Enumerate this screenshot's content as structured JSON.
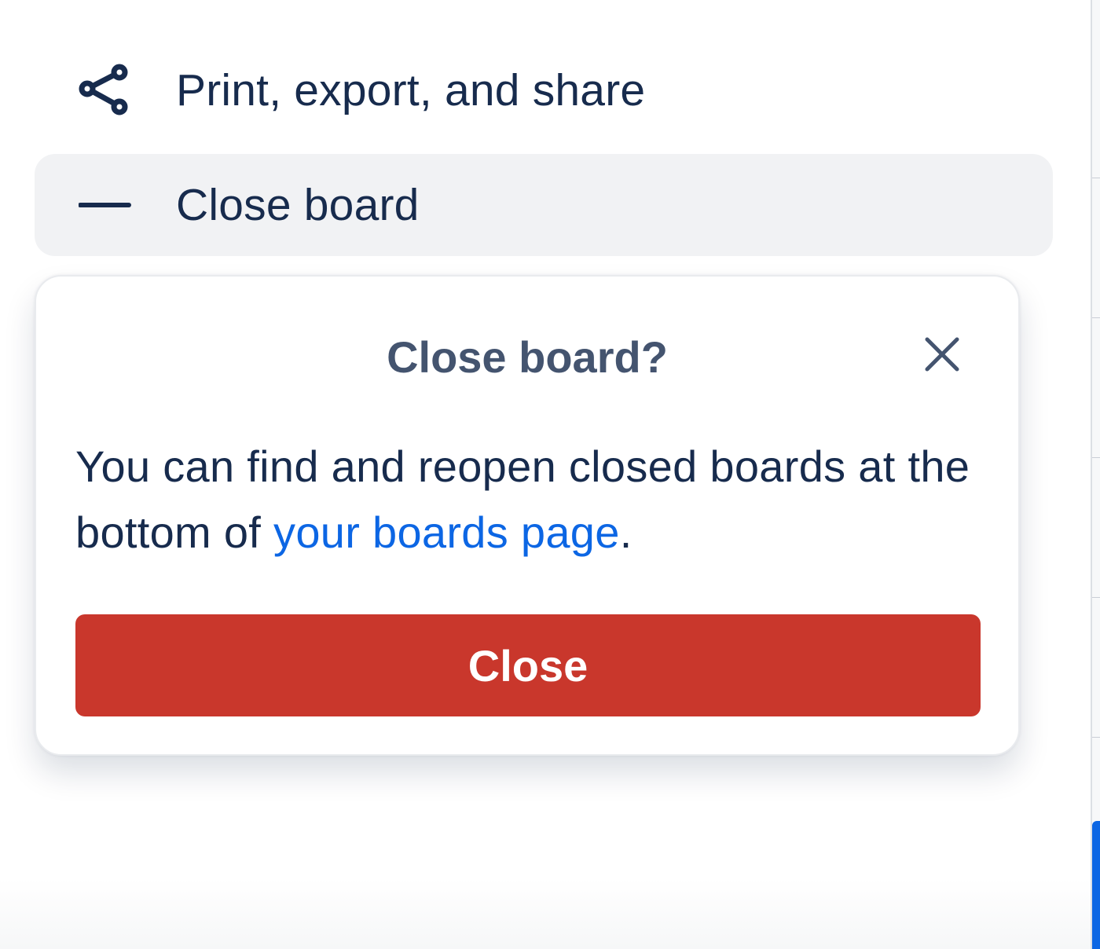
{
  "menu": {
    "share": {
      "label": "Print, export, and share",
      "icon": "share-icon"
    },
    "close_board": {
      "label": "Close board",
      "icon": "minus-icon"
    }
  },
  "popover": {
    "title": "Close board?",
    "close_icon": "close-icon",
    "body_before": "You can find and reopen closed boards at the bottom of ",
    "body_link": "your boards page",
    "body_after": ".",
    "confirm_label": "Close"
  },
  "colors": {
    "text": "#172b4d",
    "title": "#44546f",
    "link": "#0c66e4",
    "danger": "#c9372c",
    "hover_bg": "#f1f2f4"
  }
}
